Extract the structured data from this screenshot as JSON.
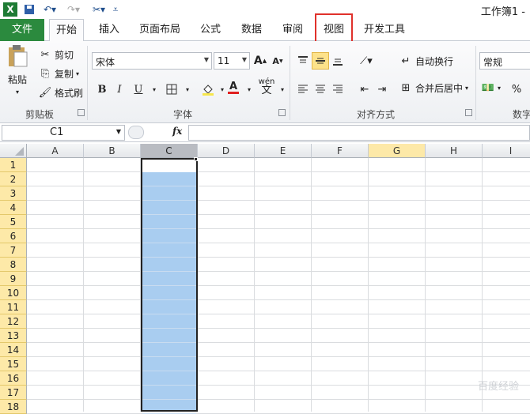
{
  "app": {
    "title": "工作簿1 - "
  },
  "quick_access": {
    "excel_icon": "excel-logo-icon",
    "save_icon": "save-icon",
    "undo_icon": "undo-icon",
    "redo_icon": "redo-icon",
    "tool_icon": "tools-icon",
    "customize_icon": "customize-toolbar-icon"
  },
  "tabs": [
    {
      "label": "文件"
    },
    {
      "label": "开始"
    },
    {
      "label": "插入"
    },
    {
      "label": "页面布局"
    },
    {
      "label": "公式"
    },
    {
      "label": "数据"
    },
    {
      "label": "审阅"
    },
    {
      "label": "视图"
    },
    {
      "label": "开发工具"
    }
  ],
  "clipboard": {
    "paste": "粘贴",
    "cut": "剪切",
    "copy": "复制",
    "format_painter": "格式刷",
    "group": "剪贴板"
  },
  "font": {
    "name": "宋体",
    "size": "11",
    "group": "字体",
    "bold": "B",
    "italic": "I",
    "underline": "U",
    "font_color_letter": "A",
    "grow": "A",
    "shrink": "A",
    "phonetic": "wén",
    "phonetic_char": "文"
  },
  "alignment": {
    "wrap": "自动换行",
    "merge": "合并后居中",
    "group": "对齐方式"
  },
  "number": {
    "format": "常规",
    "percent": "%",
    "group": "数字"
  },
  "formula_bar": {
    "name_box": "C1",
    "fx": "fx",
    "value": ""
  },
  "grid": {
    "columns": [
      "A",
      "B",
      "C",
      "D",
      "E",
      "F",
      "G",
      "H",
      "I"
    ],
    "rows": [
      "1",
      "2",
      "3",
      "4",
      "5",
      "6",
      "7",
      "8",
      "9",
      "10",
      "11",
      "12",
      "13",
      "14",
      "15",
      "16",
      "17",
      "18"
    ],
    "selected_column": "C",
    "active_cell": "C1",
    "highlight_column": "G"
  },
  "watermark": "百度经验",
  "colors": {
    "file_tab": "#2b8a3e",
    "highlight_box": "#e0312b",
    "selection": "#a9cdf0",
    "row_header": "#fde9a8"
  }
}
